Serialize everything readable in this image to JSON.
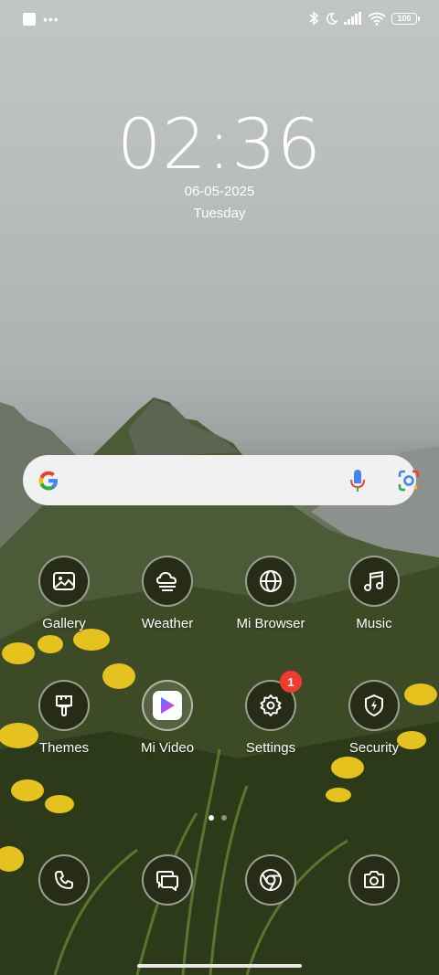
{
  "status_bar": {
    "left_icons": [
      "square-notification-icon",
      "more-dots-icon"
    ],
    "right_icons": [
      "bluetooth-icon",
      "do-not-disturb-moon-icon",
      "cellular-signal-icon",
      "wifi-icon"
    ],
    "battery": "100"
  },
  "clock": {
    "time": "02:36",
    "date": "06-05-2025",
    "day": "Tuesday"
  },
  "search_bar": {
    "icons": [
      "google-logo",
      "microphone-icon",
      "google-lens-icon"
    ]
  },
  "apps": {
    "row1": [
      {
        "label": "Gallery",
        "icon": "image-icon"
      },
      {
        "label": "Weather",
        "icon": "cloud-icon"
      },
      {
        "label": "Mi Browser",
        "icon": "globe-icon"
      },
      {
        "label": "Music",
        "icon": "music-note-icon"
      }
    ],
    "row2": [
      {
        "label": "Themes",
        "icon": "paintbrush-icon"
      },
      {
        "label": "Mi Video",
        "icon": "play-icon"
      },
      {
        "label": "Settings",
        "icon": "gear-icon",
        "badge": "1"
      },
      {
        "label": "Security",
        "icon": "shield-bolt-icon"
      }
    ]
  },
  "page_indicator": {
    "pages": 2,
    "current": 1
  },
  "dock": [
    "phone-icon",
    "messages-icon",
    "chrome-icon",
    "camera-icon"
  ],
  "colors": {
    "icon_bg": "#262c15",
    "badge": "#f23b2f",
    "search_bg": "#f1f1f1"
  }
}
